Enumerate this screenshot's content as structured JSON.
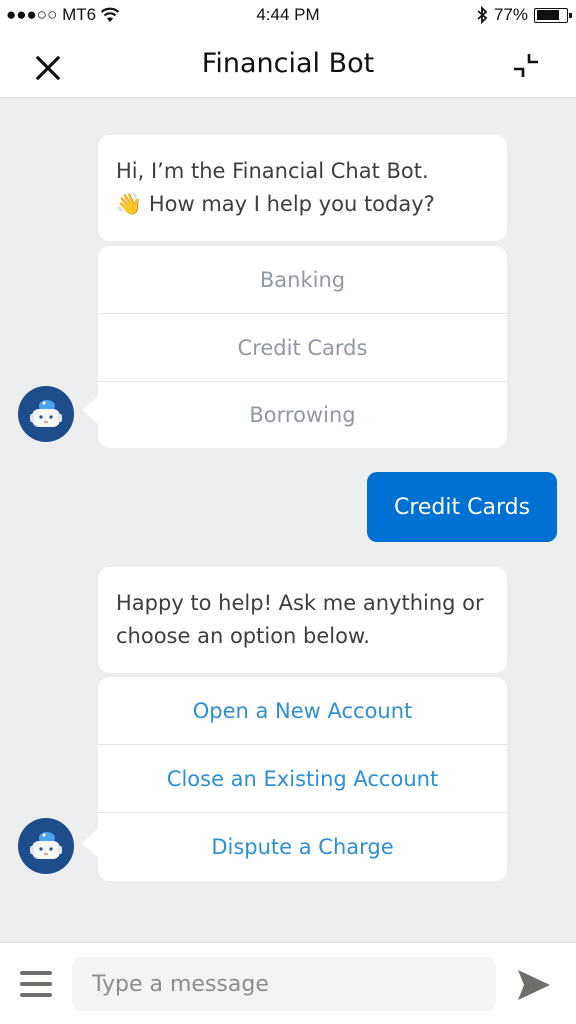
{
  "status_bar": {
    "carrier": "●●●○○ MT6",
    "time": "4:44 PM",
    "battery_percent": "77%",
    "battery_level": 0.77
  },
  "header": {
    "title": "Financial Bot",
    "close_icon": "close-icon",
    "minimize_icon": "minimize-icon"
  },
  "conversation": {
    "bot_message_1": {
      "line1": "Hi, I’m the Financial Chat Bot.",
      "line2_emoji": "👋",
      "line2": " How may I help you today?"
    },
    "options_1": [
      "Banking",
      "Credit Cards",
      "Borrowing"
    ],
    "user_message": "Credit Cards",
    "bot_message_2": {
      "text": "Happy to help! Ask me anything or choose an option below."
    },
    "options_2": [
      "Open a New Account",
      "Close an Existing Account",
      "Dispute a Charge"
    ]
  },
  "composer": {
    "placeholder": "Type a message",
    "value": "",
    "menu_icon": "menu-icon",
    "send_icon": "send-icon"
  },
  "colors": {
    "accent": "#0070d2",
    "option_link": "#2d8fd5",
    "option_disabled": "#9198a4",
    "avatar_bg": "#1d4d8a",
    "background": "#edeef0"
  }
}
